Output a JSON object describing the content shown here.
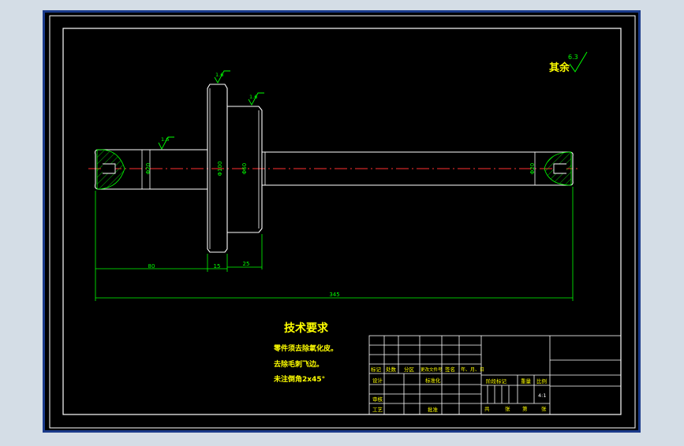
{
  "drawing": {
    "surface_finish_note": {
      "prefix": "其余",
      "value": "6.3"
    },
    "roughness_marks": [
      {
        "id": "flange",
        "value": "1.6"
      },
      {
        "id": "hub",
        "value": "1.6"
      },
      {
        "id": "left-shaft",
        "value": "1.6"
      }
    ],
    "diameter_labels": [
      {
        "id": "left-shaft",
        "text": "Φ20"
      },
      {
        "id": "flange",
        "text": "Φ100"
      },
      {
        "id": "hub",
        "text": "Φ60"
      },
      {
        "id": "right-shaft",
        "text": "Φ20"
      }
    ],
    "dimensions": {
      "left_length": "80",
      "flange_width": "15",
      "hub_width": "25",
      "total_length": "345"
    }
  },
  "tech_requirements": {
    "title": "技术要求",
    "items": [
      "零件须去除氧化皮。",
      "去除毛刺飞边。",
      "未注倒角2x45°"
    ]
  },
  "title_block": {
    "revision_headers": [
      "标记",
      "处数",
      "分区",
      "更改文件号",
      "签名",
      "年、月、日"
    ],
    "design": "设计",
    "standardize": "标准化",
    "check": "审核",
    "process": "工艺",
    "approve": "批准",
    "stage_marks": "阶段标记",
    "weight": "重量",
    "scale": "比例",
    "scale_value": "4:1",
    "sheets_total": "共",
    "sheets_unit_total": "张",
    "sheet_no": "第",
    "sheet_unit": "张"
  },
  "colors": {
    "outer_bg": "#d4dde6",
    "frame_border": "#1a3a8a",
    "canvas_bg": "#000000",
    "line_white": "#ffffff",
    "dim_green": "#00ff00",
    "center_red": "#ff3030",
    "title_yellow": "#ffff00"
  }
}
